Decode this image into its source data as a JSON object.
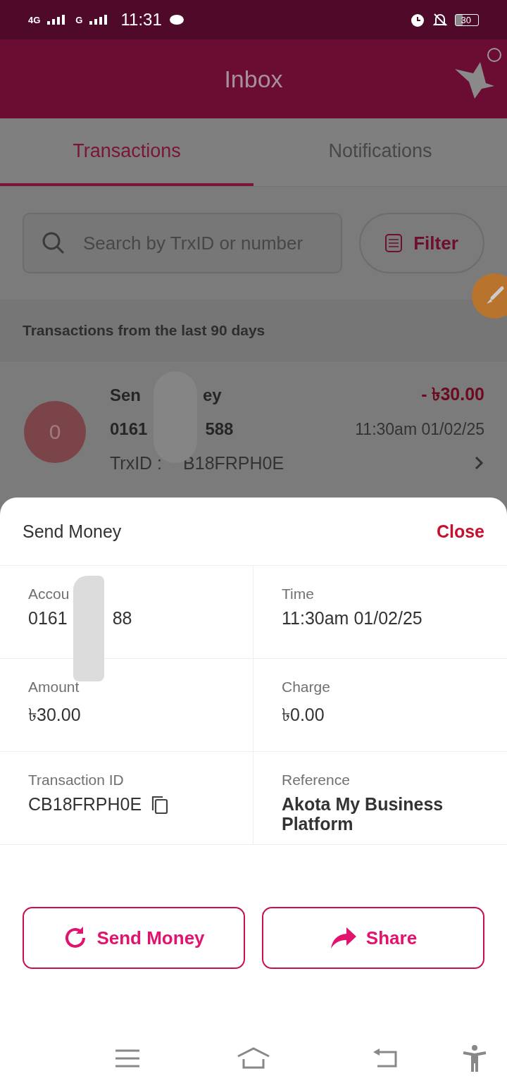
{
  "status_bar": {
    "network_1": "4G",
    "network_2": "G",
    "time": "11:31",
    "battery": "30"
  },
  "header": {
    "title": "Inbox"
  },
  "tabs": [
    {
      "label": "Transactions",
      "selected": true
    },
    {
      "label": "Notifications",
      "selected": false
    }
  ],
  "search": {
    "placeholder": "Search by TrxID or number"
  },
  "filter_button": {
    "label": "Filter"
  },
  "period_note": "Transactions from the last 90 days",
  "transactions": [
    {
      "avatar": "0",
      "title_parts": [
        "Sen",
        "ey"
      ],
      "number_parts": [
        "0161",
        "588"
      ],
      "trx_parts": [
        "TrxID :",
        "B18FRPH0E"
      ],
      "amount": "- ৳30.00",
      "time": "11:30am 01/02/25"
    }
  ],
  "details": {
    "title": "Send Money",
    "close": "Close",
    "fields": [
      {
        "kind": "redacted",
        "label": "Accou",
        "value_parts": [
          "0161",
          "88"
        ]
      },
      {
        "kind": "plain",
        "label": "Time",
        "value": "11:30am 01/02/25"
      },
      {
        "kind": "plain",
        "label": "Amount",
        "value": "৳30.00"
      },
      {
        "kind": "plain",
        "label": "Charge",
        "value": "৳0.00"
      },
      {
        "kind": "copyable",
        "label": "Transaction ID",
        "value": "CB18FRPH0E"
      },
      {
        "kind": "plain",
        "label": "Reference",
        "value": "Akota My Business Platform"
      }
    ],
    "buttons": [
      {
        "kind": "repeat",
        "label": "Send Money"
      },
      {
        "kind": "share",
        "label": "Share"
      }
    ]
  }
}
